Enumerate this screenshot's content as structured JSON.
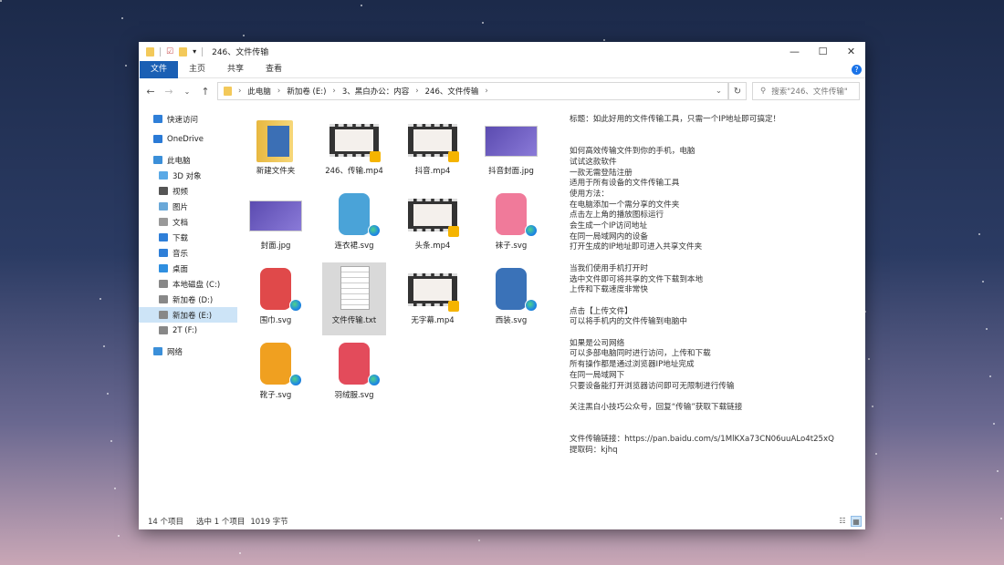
{
  "window": {
    "title": "246、文件传输",
    "controls": [
      "—",
      "☐",
      "✕"
    ]
  },
  "ribbon": {
    "tabs": [
      "文件",
      "主页",
      "共享",
      "查看"
    ]
  },
  "address": {
    "crumbs": [
      "此电脑",
      "新加卷 (E:)",
      "3、黑白办公：内容",
      "246、文件传输"
    ],
    "search_placeholder": "搜索\"246、文件传输\""
  },
  "sidebar": {
    "items": [
      {
        "label": "快速访问",
        "color": "#2f7fd8"
      },
      {
        "label": "OneDrive",
        "color": "#2a7ad6"
      },
      {
        "label": "此电脑",
        "color": "#3b8fd9"
      },
      {
        "label": "3D 对象",
        "color": "#5aa9e6"
      },
      {
        "label": "视频",
        "color": "#555"
      },
      {
        "label": "图片",
        "color": "#6aa8d8"
      },
      {
        "label": "文档",
        "color": "#999"
      },
      {
        "label": "下载",
        "color": "#2f7fd8"
      },
      {
        "label": "音乐",
        "color": "#2f7fd8"
      },
      {
        "label": "桌面",
        "color": "#2f8fe0"
      },
      {
        "label": "本地磁盘 (C:)",
        "color": "#888"
      },
      {
        "label": "新加卷 (D:)",
        "color": "#888"
      },
      {
        "label": "新加卷 (E:)",
        "color": "#888"
      },
      {
        "label": "2T (F:)",
        "color": "#888"
      },
      {
        "label": "网络",
        "color": "#3b8fd9"
      }
    ]
  },
  "files": [
    {
      "name": "新建文件夹",
      "type": "folder"
    },
    {
      "name": "246、传输.mp4",
      "type": "video"
    },
    {
      "name": "抖音.mp4",
      "type": "video"
    },
    {
      "name": "抖音封面.jpg",
      "type": "image"
    },
    {
      "name": "封面.jpg",
      "type": "image"
    },
    {
      "name": "连衣裙.svg",
      "type": "svg",
      "color": "#4aa3d8"
    },
    {
      "name": "头条.mp4",
      "type": "video"
    },
    {
      "name": "袜子.svg",
      "type": "svg",
      "color": "#f07a9a"
    },
    {
      "name": "围巾.svg",
      "type": "svg",
      "color": "#e0494a"
    },
    {
      "name": "文件传输.txt",
      "type": "txt"
    },
    {
      "name": "无字幕.mp4",
      "type": "video"
    },
    {
      "name": "西装.svg",
      "type": "svg",
      "color": "#3a72b8"
    },
    {
      "name": "靴子.svg",
      "type": "svg",
      "color": "#f0a020"
    },
    {
      "name": "羽绒服.svg",
      "type": "svg",
      "color": "#e34b5b"
    }
  ],
  "preview_text": "标题：如此好用的文件传输工具，只需一个IP地址即可搞定！\n\n\n如何高效传输文件到你的手机，电脑\n试试这款软件\n一款无需登陆注册\n适用于所有设备的文件传输工具\n使用方法：\n在电脑添加一个需分享的文件夹\n点击左上角的播放图标运行\n会生成一个IP访问地址\n在同一局域网内的设备\n打开生成的IP地址即可进入共享文件夹\n\n当我们使用手机打开时\n选中文件即可将共享的文件下载到本地\n上传和下载速度非常快\n\n点击【上传文件】\n可以将手机内的文件传输到电脑中\n\n如果是公司网络\n可以多部电脑同时进行访问，上传和下载\n所有操作都是通过浏览器IP地址完成\n在同一局域网下\n只要设备能打开浏览器访问即可无限制进行传输\n\n关注黑白小技巧公众号，回复“传输”获取下载链接\n\n\n文件传输链接：https://pan.baidu.com/s/1MlKXa73CN06uuALo4t25xQ\n提取码：kjhq",
  "status": {
    "count": "14 个项目",
    "selected": "选中 1 个项目",
    "size": "1019 字节"
  }
}
